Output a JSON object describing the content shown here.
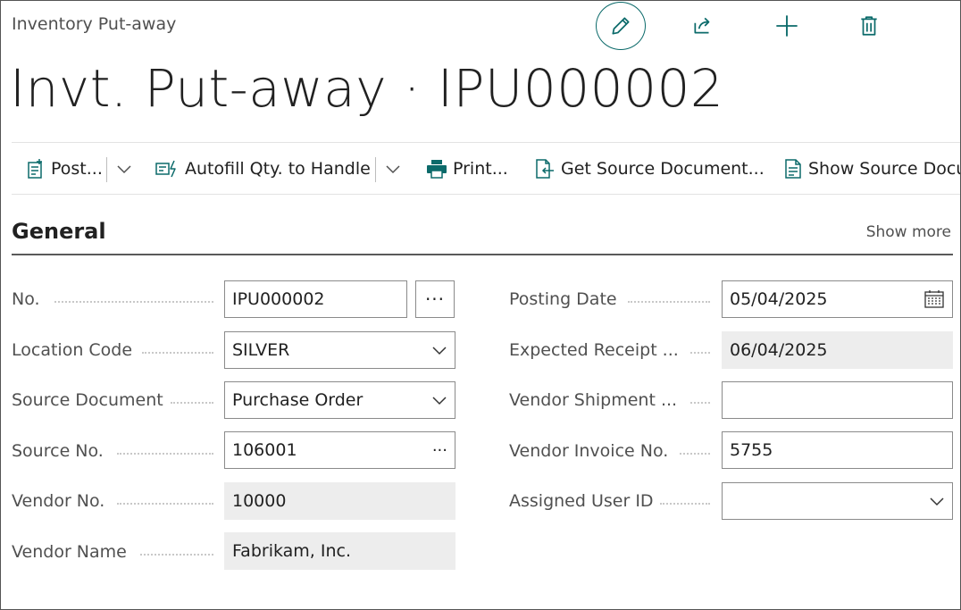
{
  "header": {
    "breadcrumb": "Inventory Put-away",
    "title": "Invt. Put-away · IPU000002"
  },
  "top_actions": {
    "edit": "pencil-icon",
    "share": "share-icon",
    "add": "plus-icon",
    "delete": "trash-icon"
  },
  "action_bar": {
    "post": "Post...",
    "autofill": "Autofill Qty. to Handle",
    "print": "Print...",
    "get_source": "Get Source Document...",
    "show_source": "Show Source Document"
  },
  "section": {
    "title": "General",
    "show_more": "Show more"
  },
  "fields": {
    "no": {
      "label": "No.",
      "value": "IPU000002"
    },
    "location_code": {
      "label": "Location Code",
      "value": "SILVER"
    },
    "source_document": {
      "label": "Source Document",
      "value": "Purchase Order"
    },
    "source_no": {
      "label": "Source No.",
      "value": "106001"
    },
    "vendor_no": {
      "label": "Vendor No.",
      "value": "10000"
    },
    "vendor_name": {
      "label": "Vendor Name",
      "value": "Fabrikam, Inc."
    },
    "posting_date": {
      "label": "Posting Date",
      "value": "05/04/2025"
    },
    "expected_receipt": {
      "label": "Expected Receipt ...",
      "value": "06/04/2025"
    },
    "vendor_shipment": {
      "label": "Vendor Shipment ...",
      "value": ""
    },
    "vendor_invoice_no": {
      "label": "Vendor Invoice No.",
      "value": "5755"
    },
    "assigned_user_id": {
      "label": "Assigned User ID",
      "value": ""
    }
  },
  "lookup_glyph": "···",
  "colors": {
    "accent": "#0b6a6a",
    "readonly_bg": "#ededed"
  }
}
